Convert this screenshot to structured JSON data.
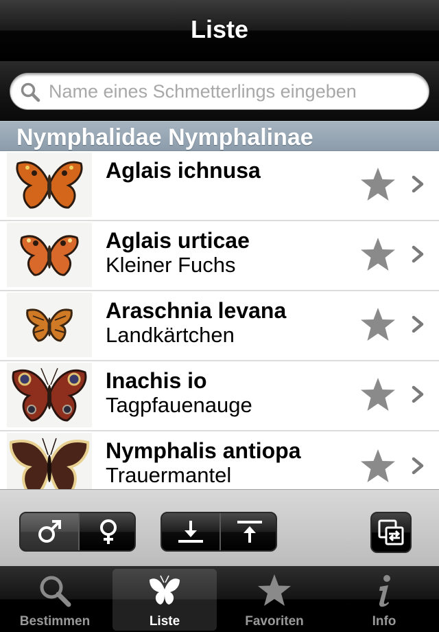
{
  "navbar": {
    "title": "Liste"
  },
  "search": {
    "placeholder": "Name eines Schmetterlings eingeben",
    "value": ""
  },
  "section": {
    "header": "Nymphalidae Nymphalinae"
  },
  "list": {
    "items": [
      {
        "title": "Aglais ichnusa",
        "subtitle": "",
        "favorite": false,
        "image": "butterfly-orange"
      },
      {
        "title": "Aglais urticae",
        "subtitle": "Kleiner Fuchs",
        "favorite": false,
        "image": "butterfly-orange"
      },
      {
        "title": "Araschnia levana",
        "subtitle": "Landkärtchen",
        "favorite": false,
        "image": "butterfly-map"
      },
      {
        "title": "Inachis io",
        "subtitle": "Tagpfauenauge",
        "favorite": false,
        "image": "butterfly-peacock"
      },
      {
        "title": "Nymphalis antiopa",
        "subtitle": "Trauermantel",
        "favorite": false,
        "image": "butterfly-mourning-cloak"
      }
    ]
  },
  "toolbar": {
    "sex_filter": {
      "options": [
        "male-symbol-icon",
        "female-symbol-icon"
      ],
      "selected": "male-symbol-icon"
    },
    "sort": {
      "options": [
        "sort-down-icon",
        "sort-up-icon"
      ]
    },
    "action": "copy-swap-icon"
  },
  "tabbar": {
    "tabs": [
      {
        "label": "Bestimmen",
        "icon": "magnifier-icon",
        "active": false
      },
      {
        "label": "Liste",
        "icon": "butterfly-icon",
        "active": true
      },
      {
        "label": "Favoriten",
        "icon": "star-icon",
        "active": false
      },
      {
        "label": "Info",
        "icon": "info-icon",
        "active": false
      }
    ]
  },
  "colors": {
    "section_header": "#94a3b1",
    "star_gray": "#8a8a8a",
    "tab_active_label": "#ffffff",
    "tab_inactive_label": "#999999"
  }
}
